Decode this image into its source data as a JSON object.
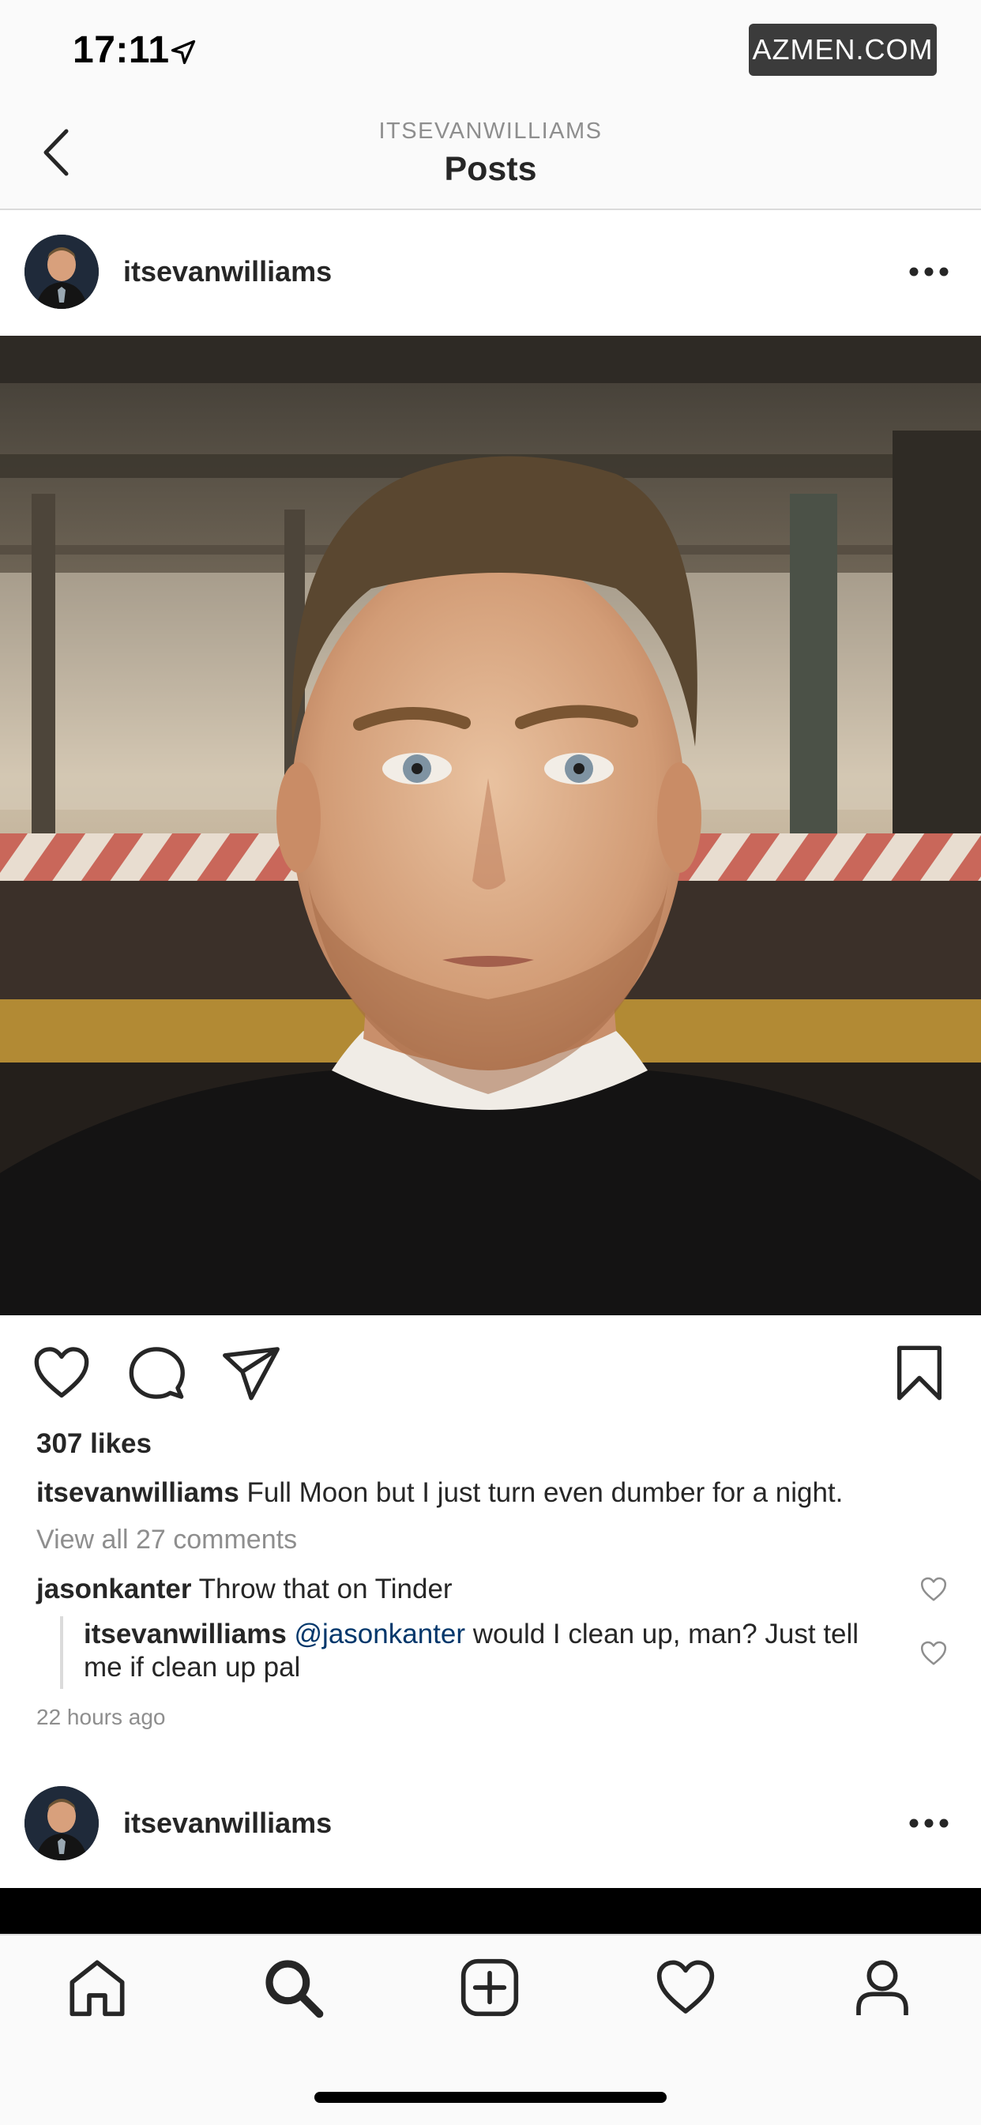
{
  "status_bar": {
    "time": "17:11",
    "watermark": "AZMEN.COM"
  },
  "header": {
    "subtitle": "ITSEVANWILLIAMS",
    "title": "Posts"
  },
  "post": {
    "username": "itsevanwilliams",
    "likes": "307 likes",
    "caption_user": "itsevanwilliams",
    "caption_text": "Full Moon but I just turn even dumber for a night.",
    "view_comments": "View all 27 comments",
    "comments": [
      {
        "user": "jasonkanter",
        "text": "Throw that on Tinder"
      },
      {
        "user": "itsevanwilliams",
        "mention": "@jasonkanter",
        "text": "would I clean up, man? Just tell me if clean up pal"
      }
    ],
    "timestamp": "22 hours ago"
  },
  "next_post": {
    "username": "itsevanwilliams"
  },
  "icons": {
    "like": "heart-icon",
    "comment": "comment-bubble-icon",
    "share": "paper-plane-icon",
    "save": "bookmark-icon",
    "more": "more-dots-icon",
    "back": "chevron-left-icon",
    "location": "location-arrow-icon"
  },
  "tab_bar": {
    "items": [
      "home",
      "search",
      "new-post",
      "activity",
      "profile"
    ],
    "active": "search"
  },
  "colors": {
    "text": "#262626",
    "secondary": "#8e8e8e",
    "mention": "#00376b",
    "divider": "#dbdbdb"
  }
}
